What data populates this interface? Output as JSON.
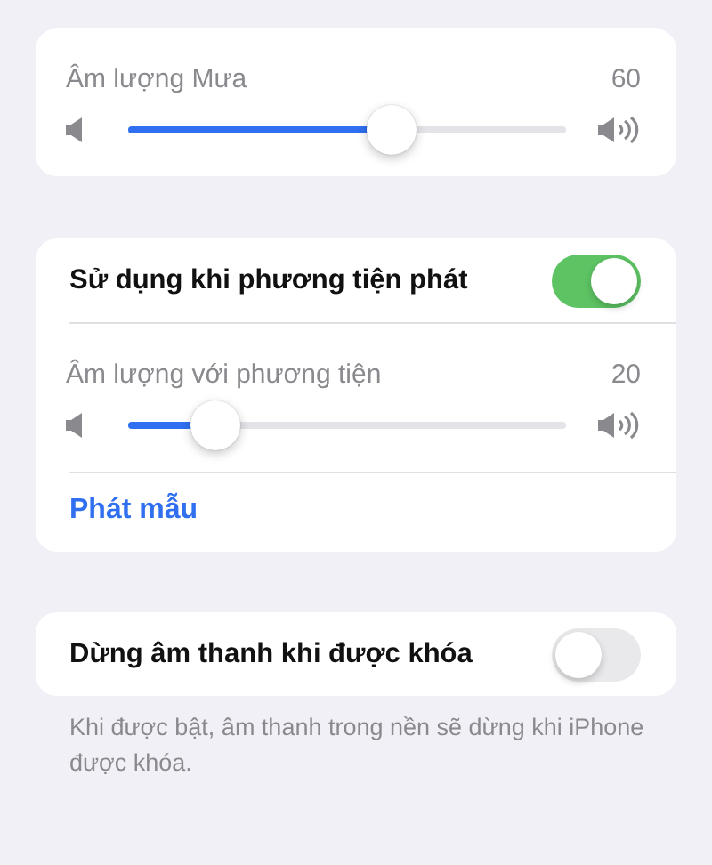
{
  "rain_volume": {
    "label": "Âm lượng Mưa",
    "reading": "60",
    "level": 0.6
  },
  "media_group": {
    "toggle": {
      "label": "Sử dụng khi phương tiện phát",
      "on": true
    },
    "volume": {
      "label": "Âm lượng với phương tiện",
      "reading": "20",
      "level": 0.2
    },
    "link": "Phát mẫu"
  },
  "lock_group": {
    "toggle": {
      "label": "Dừng âm thanh khi được khóa",
      "on": false
    },
    "footnote": "Khi được bật, âm thanh trong nền sẽ dừng khi iPhone được khóa."
  }
}
